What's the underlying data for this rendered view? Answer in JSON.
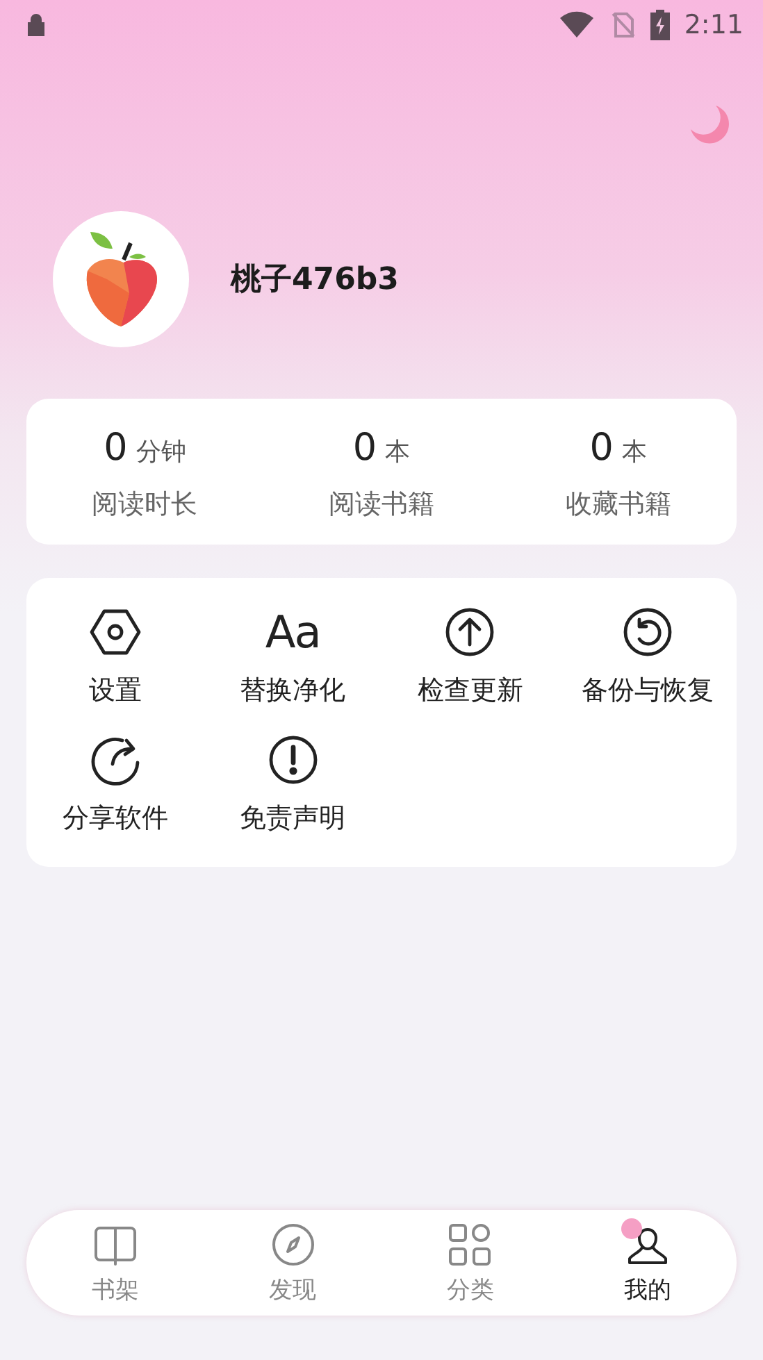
{
  "status_bar": {
    "time": "2:11"
  },
  "profile": {
    "name": "桃子476b3"
  },
  "stats": [
    {
      "value": "0",
      "unit": "分钟",
      "label": "阅读时长"
    },
    {
      "value": "0",
      "unit": "本",
      "label": "阅读书籍"
    },
    {
      "value": "0",
      "unit": "本",
      "label": "收藏书籍"
    }
  ],
  "menu": [
    {
      "kind": "settings",
      "label": "设置"
    },
    {
      "kind": "font",
      "label": "替换净化",
      "glyph": "Aa"
    },
    {
      "kind": "update",
      "label": "检查更新"
    },
    {
      "kind": "backup",
      "label": "备份与恢复"
    },
    {
      "kind": "share",
      "label": "分享软件"
    },
    {
      "kind": "disclaimer",
      "label": "免责声明"
    }
  ],
  "nav": [
    {
      "kind": "shelf",
      "label": "书架",
      "selected": false
    },
    {
      "kind": "discover",
      "label": "发现",
      "selected": false
    },
    {
      "kind": "category",
      "label": "分类",
      "selected": false
    },
    {
      "kind": "mine",
      "label": "我的",
      "selected": true
    }
  ]
}
